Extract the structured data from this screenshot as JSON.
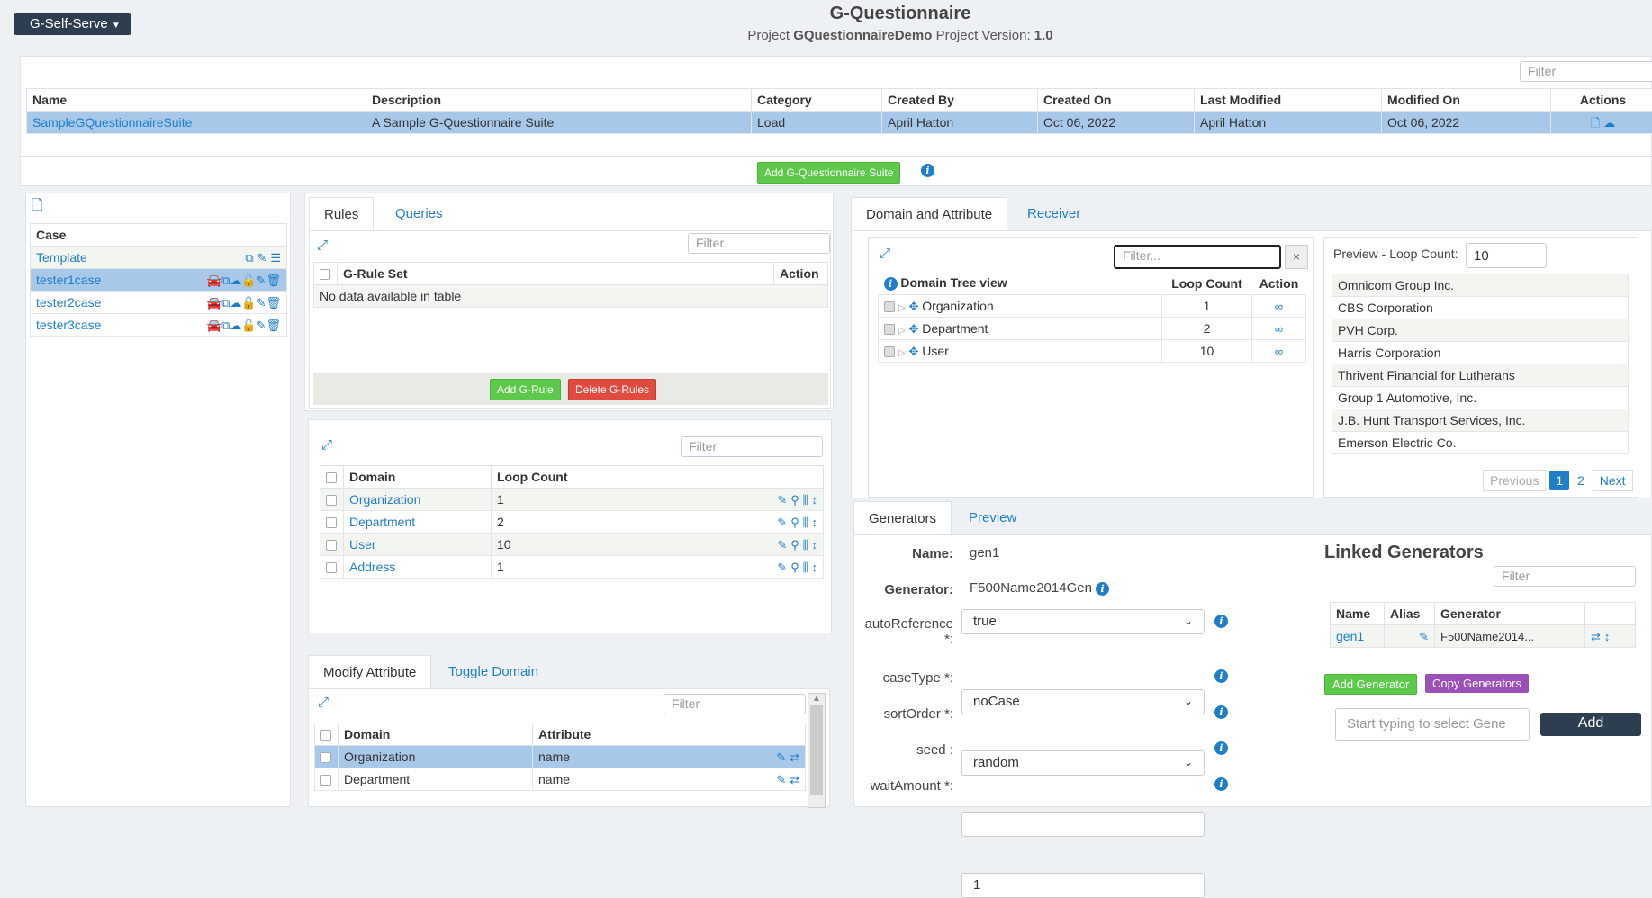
{
  "app_menu": "G-Self-Serve",
  "header": {
    "title": "G-Questionnaire",
    "project_label": "Project",
    "project_name": "GQuestionnaireDemo",
    "version_label": "Project Version:",
    "version": "1.0"
  },
  "suite_panel": {
    "filter_placeholder": "Filter",
    "columns": [
      "Name",
      "Description",
      "Category",
      "Created By",
      "Created On",
      "Last Modified",
      "Modified On",
      "Actions"
    ],
    "rows": [
      {
        "name": "SampleGQuestionnaireSuite",
        "description": "A Sample G-Questionnaire Suite",
        "category": "Load",
        "created_by": "April Hatton",
        "created_on": "Oct 06, 2022",
        "last_modified": "April Hatton",
        "modified_on": "Oct 06, 2022"
      }
    ],
    "add_button": "Add G-Questionnaire Suite"
  },
  "case_panel": {
    "header": "Case",
    "rows": [
      "Template",
      "tester1case",
      "tester2case",
      "tester3case"
    ]
  },
  "rules_panel": {
    "tabs": [
      "Rules",
      "Queries"
    ],
    "filter_placeholder": "Filter",
    "columns": [
      "G-Rule Set",
      "Action"
    ],
    "empty_text": "No data available in table",
    "add_button": "Add G-Rule",
    "delete_button": "Delete G-Rules"
  },
  "domain_panel": {
    "filter_placeholder": "Filter",
    "columns": [
      "Domain",
      "Loop Count"
    ],
    "rows": [
      {
        "domain": "Organization",
        "loop": "1"
      },
      {
        "domain": "Department",
        "loop": "2"
      },
      {
        "domain": "User",
        "loop": "10"
      },
      {
        "domain": "Address",
        "loop": "1"
      }
    ]
  },
  "modify_panel": {
    "tabs": [
      "Modify Attribute",
      "Toggle Domain"
    ],
    "filter_placeholder": "Filter",
    "columns": [
      "Domain",
      "Attribute"
    ],
    "rows": [
      {
        "domain": "Organization",
        "attribute": "name"
      },
      {
        "domain": "Department",
        "attribute": "name"
      }
    ]
  },
  "tree_panel": {
    "tabs": [
      "Domain and Attribute",
      "Receiver"
    ],
    "filter_placeholder": "Filter...",
    "clear_label": "×",
    "columns": [
      "Domain Tree view",
      "Loop Count",
      "Action"
    ],
    "rows": [
      {
        "name": "Organization",
        "loop": "1"
      },
      {
        "name": "Department",
        "loop": "2"
      },
      {
        "name": "User",
        "loop": "10"
      }
    ]
  },
  "preview_panel": {
    "label": "Preview - Loop Count:",
    "loop_value": "10",
    "items": [
      "Omnicom Group Inc.",
      "CBS Corporation",
      "PVH Corp.",
      "Harris Corporation",
      "Thrivent Financial for Lutherans",
      "Group 1 Automotive, Inc.",
      "J.B. Hunt Transport Services, Inc.",
      "Emerson Electric Co."
    ],
    "pager": {
      "previous": "Previous",
      "pages": [
        "1",
        "2"
      ],
      "next": "Next"
    }
  },
  "generator_panel": {
    "tabs": [
      "Generators",
      "Preview"
    ],
    "name_label": "Name:",
    "name_value": "gen1",
    "generator_label": "Generator:",
    "generator_value": "F500Name2014Gen",
    "fields": [
      {
        "label": "autoReference",
        "label2": "*:",
        "value": "true"
      },
      {
        "label": "caseType *:",
        "value": "noCase"
      },
      {
        "label": "sortOrder *:",
        "value": "random"
      },
      {
        "label": "seed :",
        "value": ""
      },
      {
        "label": "waitAmount *:",
        "value": "1"
      }
    ]
  },
  "linked_panel": {
    "title": "Linked Generators",
    "filter_placeholder": "Filter",
    "columns": [
      "Name",
      "Alias",
      "Generator"
    ],
    "rows": [
      {
        "name": "gen1",
        "alias": "",
        "generator": "F500Name2014..."
      }
    ],
    "add_button": "Add Generator",
    "copy_button": "Copy Generators",
    "select_placeholder": "Start typing to select Gene",
    "add_label": "Add"
  },
  "colors": {
    "accent": "#1f7ec9",
    "selected_row": "#a8c8ea",
    "green": "#5cc94a",
    "red": "#e04b3e",
    "purple": "#9b4fb8",
    "dark": "#2d3e50"
  }
}
